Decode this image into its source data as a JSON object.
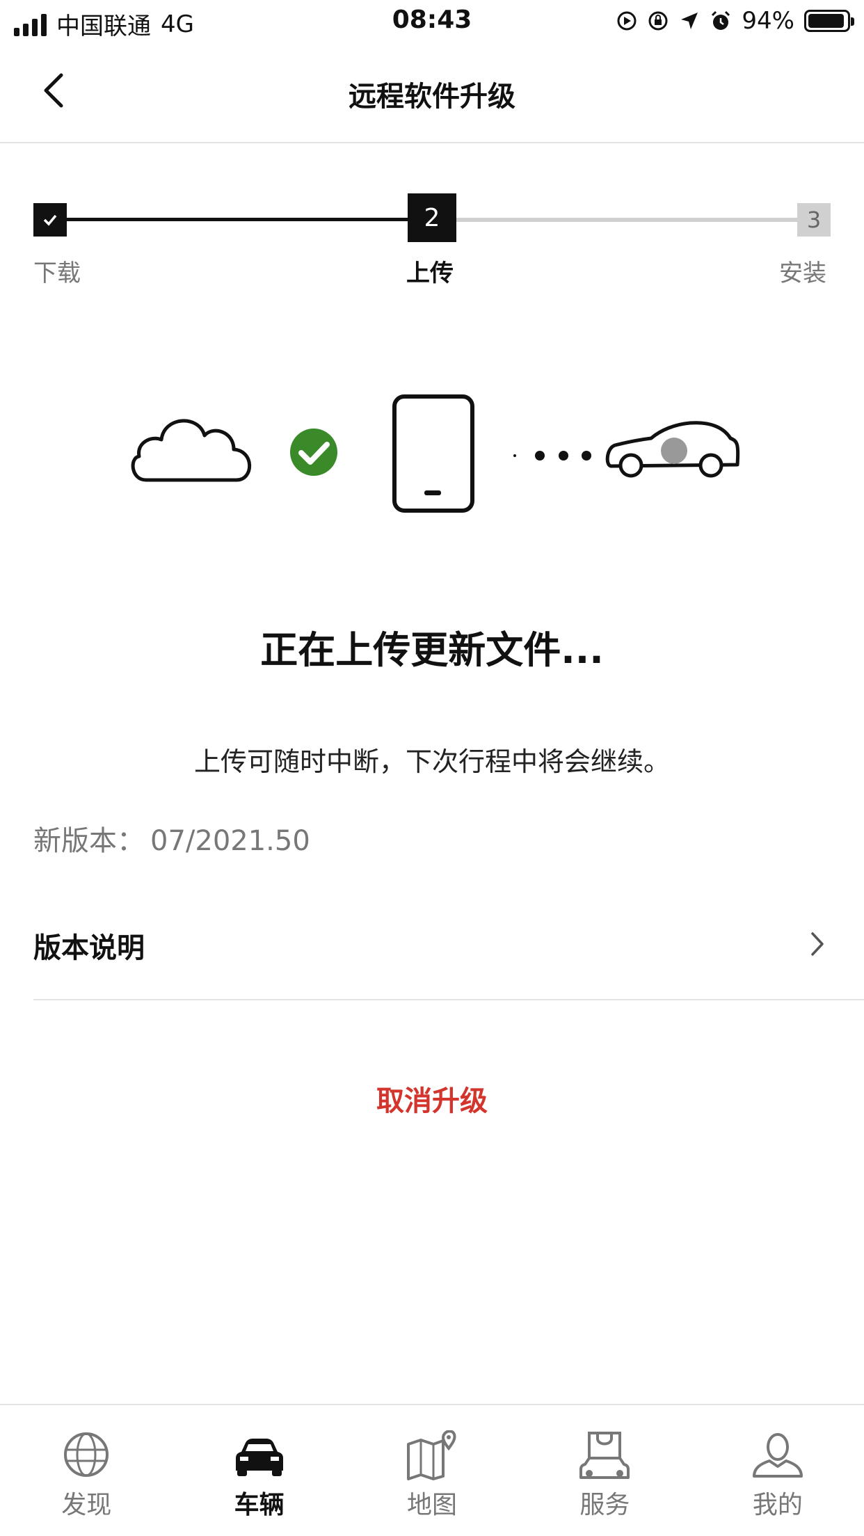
{
  "status_bar": {
    "carrier": "中国联通",
    "network": "4G",
    "time": "08:43",
    "battery": "94%",
    "battery_level": 0.94
  },
  "header": {
    "title": "远程软件升级",
    "back_icon": "chevron-left-icon"
  },
  "stepper": {
    "steps": [
      {
        "number": "",
        "label": "下载",
        "state": "done"
      },
      {
        "number": "2",
        "label": "上传",
        "state": "active"
      },
      {
        "number": "3",
        "label": "安装",
        "state": "pending"
      }
    ]
  },
  "illustration": {
    "icons": [
      "cloud-icon",
      "check-circle-icon",
      "phone-icon",
      "dots-icon",
      "car-icon"
    ],
    "check_color": "#3a8a2a"
  },
  "main": {
    "headline": "正在上传更新文件...",
    "subtext": "上传可随时中断，下次行程中将会继续。",
    "version_label": "新版本：",
    "version_value": "07/2021.50",
    "release_notes": "版本说明",
    "cancel": "取消升级",
    "cancel_color": "#d3342c"
  },
  "tabbar": {
    "items": [
      {
        "label": "发现",
        "icon": "globe-icon",
        "active": false
      },
      {
        "label": "车辆",
        "icon": "car-icon",
        "active": true
      },
      {
        "label": "地图",
        "icon": "map-icon",
        "active": false
      },
      {
        "label": "服务",
        "icon": "service-icon",
        "active": false
      },
      {
        "label": "我的",
        "icon": "profile-icon",
        "active": false
      }
    ]
  }
}
